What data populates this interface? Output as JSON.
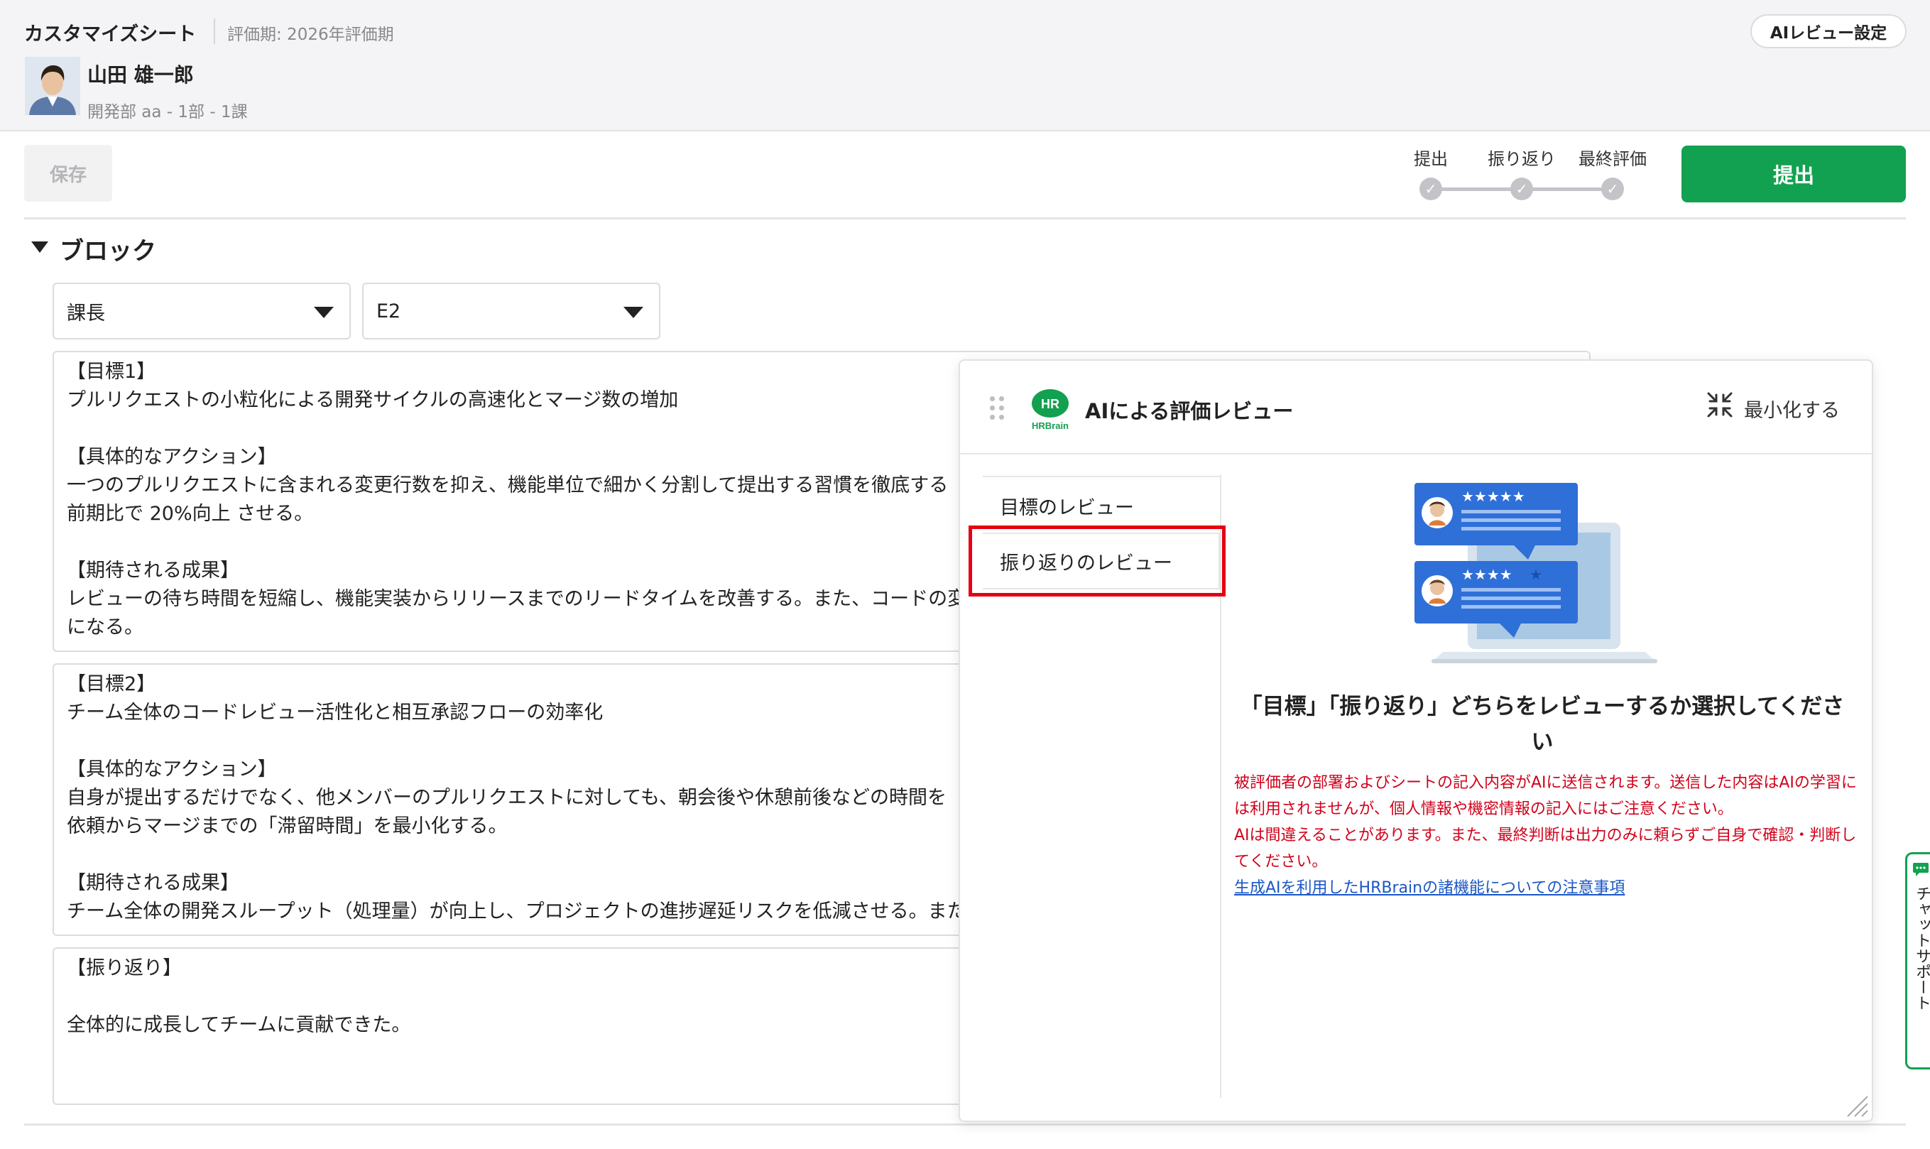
{
  "header": {
    "sheet_title": "カスタマイズシート",
    "period": "評価期: 2026年評価期",
    "user_name": "山田 雄一郎",
    "user_dept": "開発部 aa - 1部 - 1課",
    "ai_settings_label": "AIレビュー設定"
  },
  "toolbar": {
    "save_label": "保存",
    "steps": [
      "提出",
      "振り返り",
      "最終評価"
    ],
    "submit_label": "提出"
  },
  "block": {
    "title": "ブロック",
    "select_role": "課長",
    "select_grade": "E2",
    "goal1": "【目標1】\nプルリクエストの小粒化による開発サイクルの高速化とマージ数の増加\n\n【具体的なアクション】\n一つのプルリクエストに含まれる変更行数を抑え、機能単位で細かく分割して提出する習慣を徹底する\n前期比で 20%向上 させる。\n\n【期待される成果】\nレビューの待ち時間を短縮し、機能実装からリリースまでのリードタイムを改善する。また、コードの変\nになる。",
    "goal2": "【目標2】\nチーム全体のコードレビュー活性化と相互承認フローの効率化\n\n【具体的なアクション】\n自身が提出するだけでなく、他メンバーのプルリクエストに対しても、朝会後や休憩前後などの時間を\n依頼からマージまでの「滞留時間」を最小化する。\n\n【期待される成果】\nチーム全体の開発スループット（処理量）が向上し、プロジェクトの進捗遅延リスクを低減させる。また",
    "reflection": "【振り返り】\n\n全体的に成長してチームに貢献できた。"
  },
  "ai_panel": {
    "logo_text": "HR",
    "logo_sub": "HRBrain",
    "title": "AIによる評価レビュー",
    "minimize_label": "最小化する",
    "nav_goal_review": "目標のレビュー",
    "nav_reflection_review": "振り返りのレビュー",
    "prompt": "「目標」「振り返り」どちらをレビューするか選択してください",
    "notice1": "被評価者の部署およびシートの記入内容がAIに送信されます。送信した内容はAIの学習には利用されませんが、個人情報や機密情報の記入にはご注意ください。",
    "notice2": "AIは間違えることがあります。また、最終判断は出力のみに頼らずご自身で確認・判断してください。",
    "link": "生成AIを利用したHRBrainの諸機能についての注意事項"
  },
  "chat_support": {
    "label": "チャットサポート"
  },
  "colors": {
    "accent_green": "#12a150",
    "warning_red": "#d0021b",
    "highlight_red": "#e60012",
    "link_blue": "#1a56c4"
  },
  "icons": [
    "avatar-photo",
    "drag-handle-icon",
    "hrbrain-logo",
    "minimize-icon",
    "review-illustration",
    "check-icon",
    "chat-icon",
    "resize-grip-icon",
    "caret-down-icon"
  ]
}
